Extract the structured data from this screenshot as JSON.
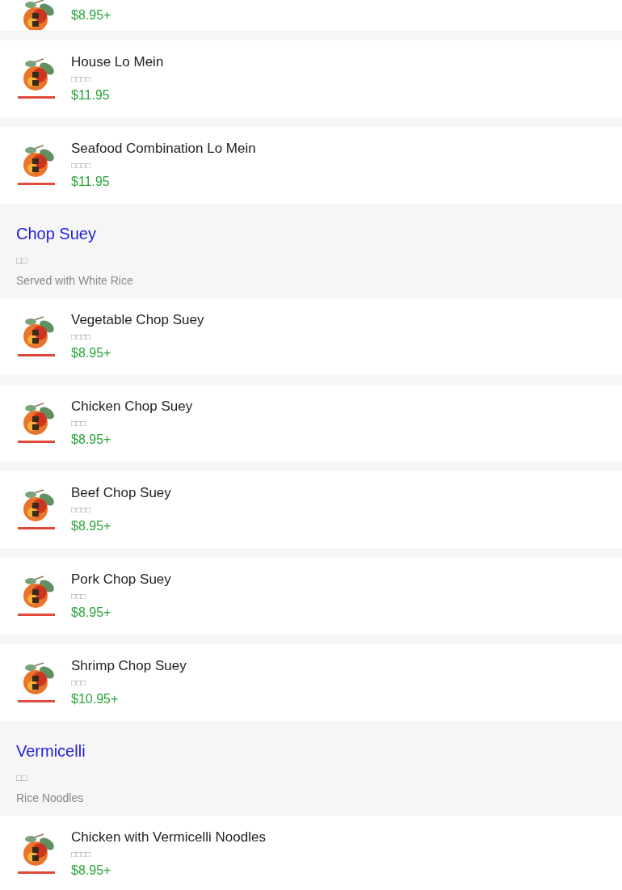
{
  "menu": [
    {
      "kind": "item_cut",
      "price": "$8.95+"
    },
    {
      "kind": "item",
      "name": "House Lo Mein",
      "subtitle": "□□□□",
      "price": "$11.95"
    },
    {
      "kind": "item",
      "name": "Seafood Combination Lo Mein",
      "subtitle": "□□□□",
      "price": "$11.95"
    },
    {
      "kind": "category",
      "title": "Chop Suey",
      "subtitle": "□□",
      "description": "Served with White Rice"
    },
    {
      "kind": "item",
      "name": "Vegetable Chop Suey",
      "subtitle": "□□□□",
      "price": "$8.95+"
    },
    {
      "kind": "item",
      "name": "Chicken Chop Suey",
      "subtitle": "□□□",
      "price": "$8.95+"
    },
    {
      "kind": "item",
      "name": "Beef Chop Suey",
      "subtitle": "□□□□",
      "price": "$8.95+"
    },
    {
      "kind": "item",
      "name": "Pork Chop Suey",
      "subtitle": "□□□",
      "price": "$8.95+"
    },
    {
      "kind": "item",
      "name": "Shrimp Chop Suey",
      "subtitle": "□□□",
      "price": "$10.95+"
    },
    {
      "kind": "category",
      "title": "Vermicelli",
      "subtitle": "□□",
      "description": "Rice Noodles"
    },
    {
      "kind": "item",
      "name": "Chicken with Vermicelli Noodles",
      "subtitle": "□□□□",
      "price": "$8.95+"
    }
  ]
}
